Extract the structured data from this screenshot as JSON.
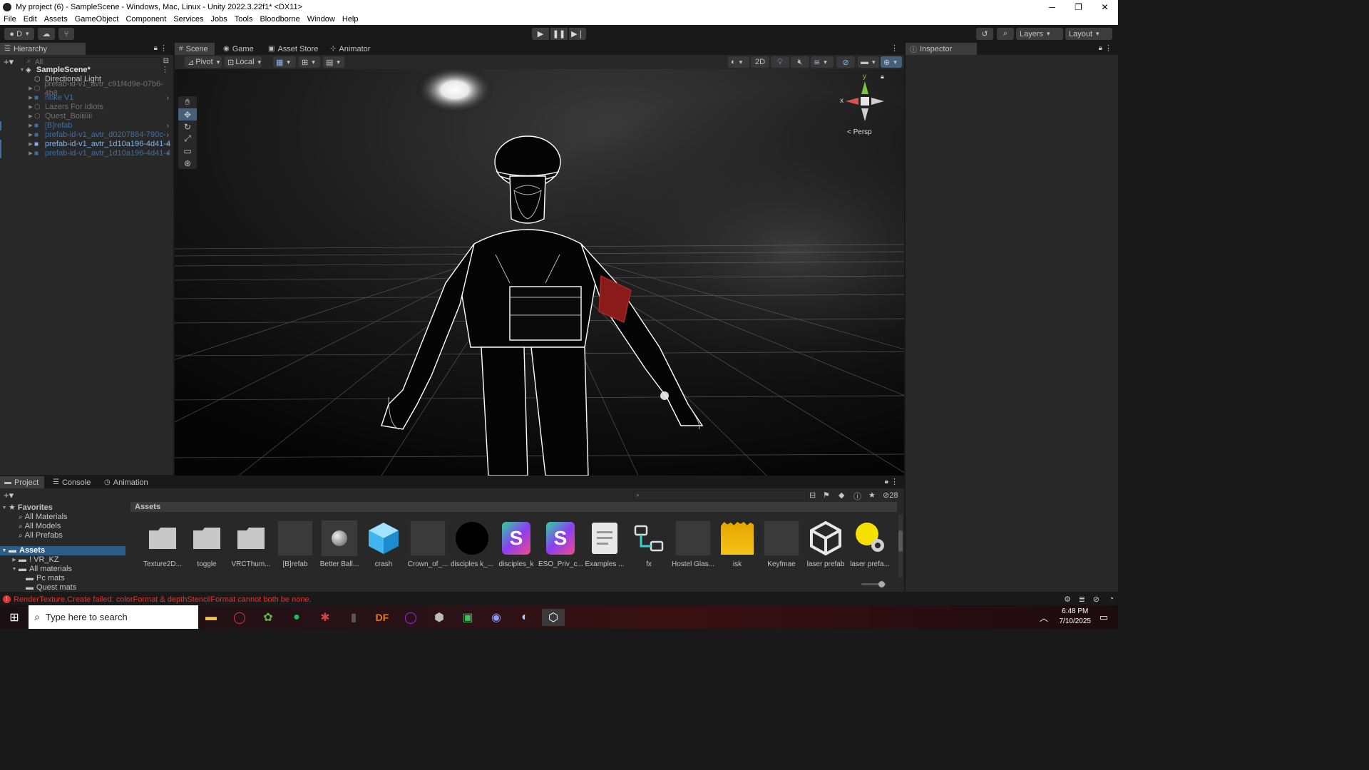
{
  "window": {
    "title": "My project (6) - SampleScene - Windows, Mac, Linux - Unity 2022.3.22f1* <DX11>",
    "controls": [
      "─",
      "❐",
      "✕"
    ]
  },
  "menubar": [
    "File",
    "Edit",
    "Assets",
    "GameObject",
    "Component",
    "Services",
    "Jobs",
    "Tools",
    "Bloodborne",
    "Window",
    "Help"
  ],
  "toolbar": {
    "account_label": "D",
    "layers_label": "Layers",
    "layout_label": "Layout"
  },
  "hierarchy": {
    "tab": "Hierarchy",
    "search_placeholder": "All",
    "scene_name": "SampleScene*",
    "items": [
      {
        "label": "Directional Light",
        "color": "#c4c4c4"
      },
      {
        "label": "prefab-id-v1_avtr_c91f4d9e-07b6-4b8",
        "color": "#6f6f6f"
      },
      {
        "label": "nuke V1",
        "color": "#3f6fa6"
      },
      {
        "label": "Lazers For Idiots",
        "color": "#6f6f6f"
      },
      {
        "label": "Quest_Boiiiiiii",
        "color": "#6f6f6f"
      },
      {
        "label": "[B]refab",
        "color": "#3f6fa6"
      },
      {
        "label": "prefab-id-v1_avtr_d0207884-790c-",
        "color": "#3f6fa6"
      },
      {
        "label": "prefab-id-v1_avtr_1d10a196-4d41-4",
        "color": "#7fb4ee"
      },
      {
        "label": "prefab-id-v1_avtr_1d10a196-4d41-4",
        "color": "#3f6fa6"
      }
    ]
  },
  "scene_tabs": [
    {
      "label": "Scene",
      "icon": "#"
    },
    {
      "label": "Game",
      "icon": "◉"
    },
    {
      "label": "Asset Store",
      "icon": "▣"
    },
    {
      "label": "Animator",
      "icon": "⊹"
    }
  ],
  "scene_toolbar": {
    "pivot": "Pivot",
    "local": "Local",
    "mode_2d": "2D"
  },
  "gizmo": {
    "persp_label": "Persp",
    "axis_y": "y",
    "axis_x": "x"
  },
  "inspector": {
    "tab": "Inspector"
  },
  "project": {
    "tabs": [
      "Project",
      "Console",
      "Animation"
    ],
    "hidden_count": "28",
    "favorites": {
      "label": "Favorites",
      "items": [
        "All Materials",
        "All Models",
        "All Prefabs"
      ]
    },
    "assets_root": "Assets",
    "tree": [
      "! VR_KZ",
      "All materials",
      "Pc mats",
      "Quest mats"
    ],
    "breadcrumb": "Assets",
    "assets": [
      {
        "label": "Texture2D...",
        "icon": "folder"
      },
      {
        "label": "toggle",
        "icon": "folder"
      },
      {
        "label": "VRCThum...",
        "icon": "folder"
      },
      {
        "label": "[B]refab",
        "icon": "prefab-dark"
      },
      {
        "label": "Better Ball...",
        "icon": "sphere"
      },
      {
        "label": "crash",
        "icon": "cube-blue"
      },
      {
        "label": "Crown_of_...",
        "icon": "prefab-dark"
      },
      {
        "label": "disciples k_...",
        "icon": "black-sphere"
      },
      {
        "label": "disciples_k",
        "icon": "script"
      },
      {
        "label": "ESO_Priv_c...",
        "icon": "script"
      },
      {
        "label": "Examples ...",
        "icon": "document"
      },
      {
        "label": "fx",
        "icon": "animator"
      },
      {
        "label": "Hostel Glas...",
        "icon": "prefab-dark"
      },
      {
        "label": "isk",
        "icon": "audio"
      },
      {
        "label": "Keyfmae",
        "icon": "prefab-dark"
      },
      {
        "label": "laser prefab",
        "icon": "unity"
      },
      {
        "label": "laser prefa...",
        "icon": "light-gear"
      }
    ]
  },
  "status": {
    "message": "RenderTexture.Create failed: colorFormat & depthStencilFormat cannot both be none."
  },
  "taskbar": {
    "search_placeholder": "Type here to search",
    "time": "6:48 PM",
    "date": "7/10/2025",
    "dock_label": "DF"
  }
}
